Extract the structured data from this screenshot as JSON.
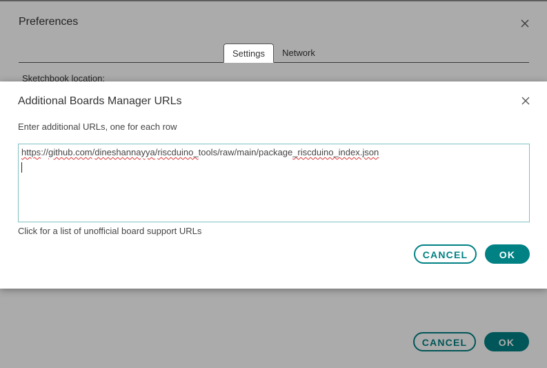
{
  "preferences": {
    "title": "Preferences",
    "tabs": [
      {
        "label": "Settings",
        "active": true
      },
      {
        "label": "Network",
        "active": false
      }
    ],
    "sketchbook_label": "Sketchbook location:",
    "cancel_label": "CANCEL",
    "ok_label": "OK"
  },
  "modal": {
    "title": "Additional Boards Manager URLs",
    "subtitle": "Enter additional URLs, one for each row",
    "urls": [
      "https://github.com/dineshannayya/riscduino_tools/raw/main/package_riscduino_index.json"
    ],
    "url_segments": [
      {
        "text": "https",
        "misspelled": true
      },
      {
        "text": "://",
        "misspelled": false
      },
      {
        "text": "github.com",
        "misspelled": true
      },
      {
        "text": "/",
        "misspelled": false
      },
      {
        "text": "dineshannayya",
        "misspelled": true
      },
      {
        "text": "/",
        "misspelled": false
      },
      {
        "text": "riscduino_",
        "misspelled": true
      },
      {
        "text": "tools/raw/main/package",
        "misspelled": false
      },
      {
        "text": "_riscduino_index.json",
        "misspelled": true
      }
    ],
    "unofficial_link": "Click for a list of unofficial board support URLs",
    "cancel_label": "CANCEL",
    "ok_label": "OK"
  },
  "colors": {
    "accent": "#008184",
    "overlay": "rgba(0,0,0,0.33)",
    "spellcheck": "#dd3333"
  },
  "icons": {
    "close": "close-icon"
  }
}
